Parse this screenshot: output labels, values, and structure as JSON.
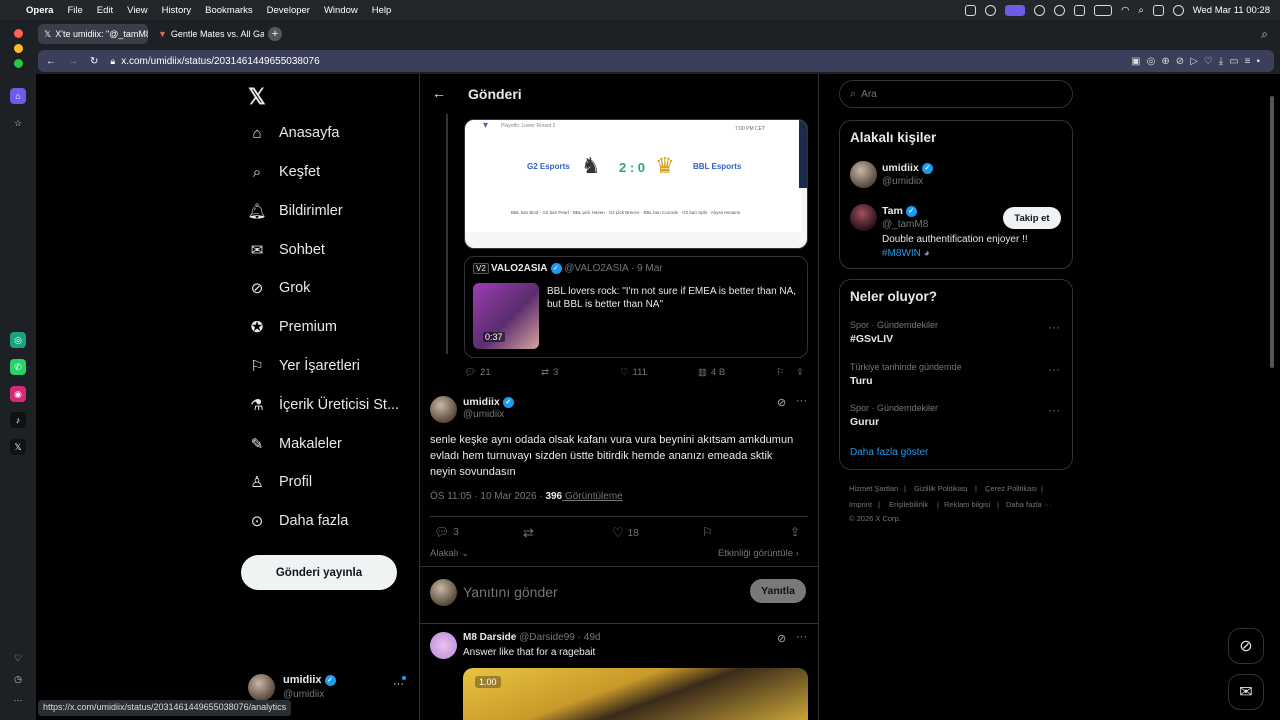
{
  "menubar": {
    "apple": "",
    "app": "Opera",
    "items": [
      "File",
      "Edit",
      "View",
      "History",
      "Bookmarks",
      "Developer",
      "Window",
      "Help"
    ],
    "clock": "Wed Mar 11  00:28"
  },
  "tabs": [
    {
      "label": "X'te umidiix: \"@_tamM8"
    },
    {
      "label": "Gentle Mates vs. All Gam"
    }
  ],
  "url": "x.com/umidiix/status/2031461449655038076",
  "nav": {
    "items": [
      "Anasayfa",
      "Keşfet",
      "Bildirimler",
      "Sohbet",
      "Grok",
      "Premium",
      "Yer İşaretleri",
      "İçerik Üreticisi St...",
      "Makaleler",
      "Profil",
      "Daha fazla"
    ],
    "post_button": "Gönderi yayınla"
  },
  "account": {
    "name": "umidiix",
    "handle": "@umidiix"
  },
  "header": {
    "title": "Gönderi"
  },
  "match_card": {
    "team1": "G2 Esports",
    "team2": "BBL Esports",
    "score": "2 : 0",
    "subtitle": "Playoffs: Lower Round 2",
    "time": "7:00 PM CET",
    "bans": "BBL ban Bind · G2 ban Pearl · BBL pick Haven · G2 pick Breeze · BBL ban Corrode · G2 ban Split · Abyss remains"
  },
  "quote": {
    "author": "VALO2ASIA",
    "handle": "@VALO2ASIA",
    "date": "9 Mar",
    "text": "BBL lovers rock: \"I'm not sure if EMEA is better than NA, but BBL is better than NA\"",
    "duration": "0:37"
  },
  "parent_stats": {
    "replies": "21",
    "reposts": "3",
    "likes": "111",
    "views": "4 B"
  },
  "main_post": {
    "author": "umidiix",
    "handle": "@umidiix",
    "text": "senle keşke aynı odada olsak kafanı vura vura beynini akıtsam amkdumun evladı hem turnuvayı sizden üstte bitirdik hemde ananızı emeada sktik neyin sovundasın",
    "meta": "ÖS 11:05 · 10 Mar 2026 · ",
    "views_count": "396",
    "views_label": " Görüntüleme",
    "replies": "3",
    "likes": "18",
    "related": "Alakalı",
    "activity": "Etkinliği görüntüle"
  },
  "reply_box": {
    "placeholder": "Yanıtını gönder",
    "button": "Yanıtla"
  },
  "reply": {
    "author": "M8 Darside",
    "handle": "@Darside99",
    "date": "49d",
    "text": "Answer like that for a ragebait",
    "gif_label": "1.00"
  },
  "search": {
    "placeholder": "Ara"
  },
  "related_people": {
    "title": "Alakalı kişiler",
    "people": [
      {
        "name": "umidiix",
        "handle": "@umidiix"
      },
      {
        "name": "Tam",
        "handle": "@_tamM8",
        "bio": "Double authentification enjoyer !!",
        "tag": "#M8WIN",
        "follow": "Takip et"
      }
    ]
  },
  "trends": {
    "title": "Neler oluyor?",
    "items": [
      {
        "context": "Spor · Gündemdekiler",
        "name": "#GSvLIV"
      },
      {
        "context": "Türkiye tarihinde gündemde",
        "name": "Turu"
      },
      {
        "context": "Spor · Gündemdekiler",
        "name": "Gurur"
      }
    ],
    "more": "Daha fazla göster"
  },
  "footer": {
    "row1": [
      "Hizmet Şartları",
      "Gizlilik Politikası",
      "Çerez Politikası"
    ],
    "row2": [
      "Imprint",
      "Erişilebilirlik",
      "Reklam bilgisi",
      "Daha fazla ···"
    ],
    "copyright": "© 2026 X Corp."
  },
  "status_url": "https://x.com/umidiix/status/2031461449655038076/analytics",
  "colors": {
    "accent": "#1d9bf0",
    "bg": "#000000",
    "border": "#2f3336",
    "text": "#e7e9ea",
    "muted": "#71767b"
  }
}
